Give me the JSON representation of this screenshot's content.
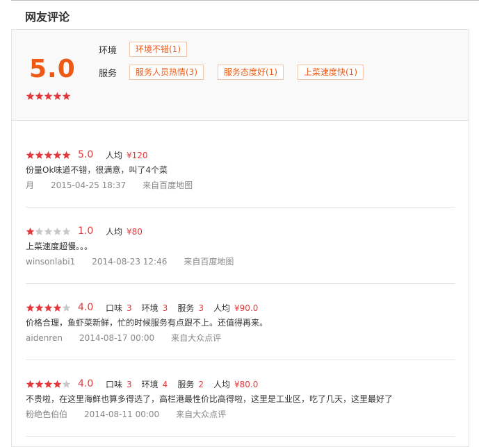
{
  "section": {
    "title": "网友评论"
  },
  "summary": {
    "score": "5.0",
    "stars": 5,
    "rows": [
      {
        "label": "环境",
        "tags": [
          "环境不错(1)"
        ]
      },
      {
        "label": "服务",
        "tags": [
          "服务人员热情(3)",
          "服务态度好(1)",
          "上菜速度快(1)"
        ]
      }
    ]
  },
  "colors": {
    "accent": "#ee5a14",
    "star_on": "#e4393c",
    "star_off": "#c8c8c8"
  },
  "reviews": [
    {
      "stars": 5,
      "score": "5.0",
      "attrs": [
        {
          "k": "人均",
          "v": "¥120"
        }
      ],
      "content": "份量Ok味道不错，很满意，叫了4个菜",
      "user": "月",
      "time": "2015-04-25 18:37",
      "source": "来自百度地图"
    },
    {
      "stars": 1,
      "score": "1.0",
      "attrs": [
        {
          "k": "人均",
          "v": "¥80"
        }
      ],
      "content": "上菜速度超慢。。。",
      "user": "winsonlabi1",
      "time": "2014-08-23 12:46",
      "source": "来自百度地图"
    },
    {
      "stars": 4,
      "score": "4.0",
      "attrs": [
        {
          "k": "口味",
          "v": "3"
        },
        {
          "k": "环境",
          "v": "3"
        },
        {
          "k": "服务",
          "v": "3"
        },
        {
          "k": "人均",
          "v": "¥90.0"
        }
      ],
      "content": "价格合理，鱼虾菜新鲜，忙的时候服务有点跟不上。还值得再来。",
      "user": "aidenren",
      "time": "2014-08-17 00:00",
      "source": "来自大众点评"
    },
    {
      "stars": 4,
      "score": "4.0",
      "attrs": [
        {
          "k": "口味",
          "v": "3"
        },
        {
          "k": "环境",
          "v": "4"
        },
        {
          "k": "服务",
          "v": "2"
        },
        {
          "k": "人均",
          "v": "¥80.0"
        }
      ],
      "content": "不贵啦，在这里海鲜也算多得选了，高栏港最性价比高得啦，这里是工业区，吃了几天，这里最好了",
      "user": "粉绝色伯伯",
      "time": "2014-08-11 00:00",
      "source": "来自大众点评"
    }
  ]
}
